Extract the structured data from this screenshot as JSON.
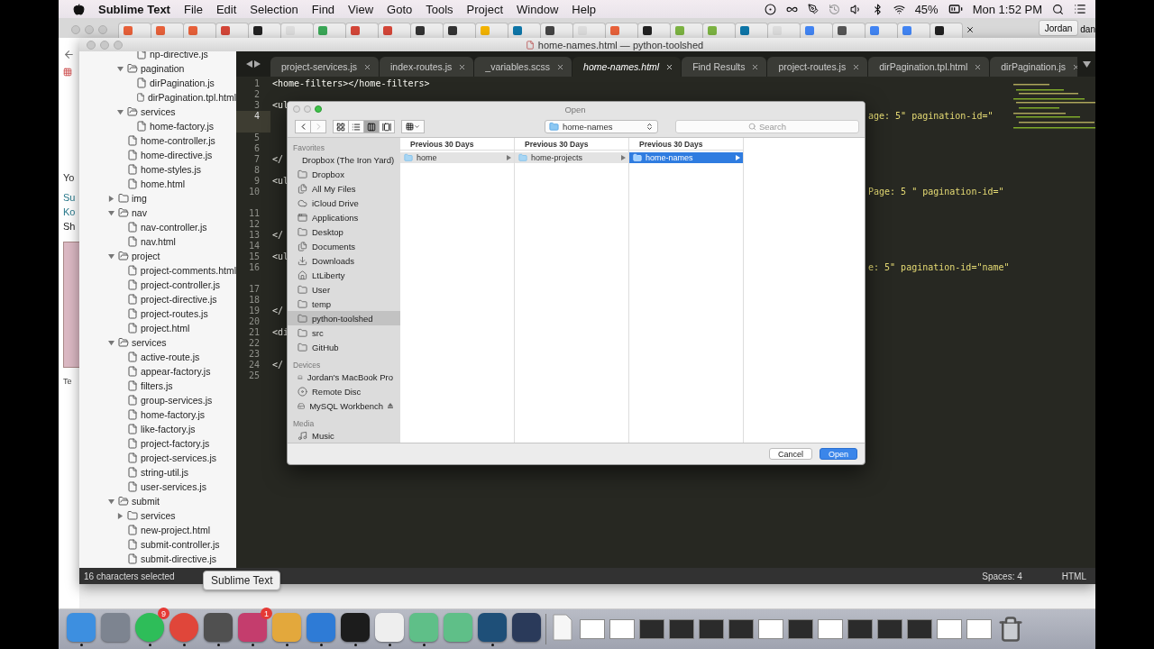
{
  "menu_bar": {
    "app": "Sublime Text",
    "menus": [
      "File",
      "Edit",
      "Selection",
      "Find",
      "View",
      "Goto",
      "Tools",
      "Project",
      "Window",
      "Help"
    ],
    "battery": "45%",
    "clock": "Mon 1:52 PM"
  },
  "browser": {
    "tabs": [
      {
        "color": "#e8613a"
      },
      {
        "color": "#e8613a"
      },
      {
        "color": "#e8613a"
      },
      {
        "color": "#d44638"
      },
      {
        "color": "#222222"
      },
      {
        "color": "#dddddd"
      },
      {
        "color": "#3aa757"
      },
      {
        "color": "#d44638"
      },
      {
        "color": "#d44638"
      },
      {
        "color": "#333333"
      },
      {
        "color": "#333333"
      },
      {
        "color": "#f4b400"
      },
      {
        "color": "#0e76a8"
      },
      {
        "color": "#444444"
      },
      {
        "color": "#dddddd"
      },
      {
        "color": "#e8613a"
      },
      {
        "color": "#222222"
      },
      {
        "color": "#7cb342"
      },
      {
        "color": "#7cb342"
      },
      {
        "color": "#0e76a8"
      },
      {
        "color": "#dddddd"
      },
      {
        "color": "#4285f4"
      },
      {
        "color": "#555555"
      },
      {
        "color": "#4285f4"
      },
      {
        "color": "#4285f4"
      },
      {
        "color": "#222222"
      }
    ],
    "profile": "Jordan",
    "other_window": "dan",
    "page_fragments": [
      "Yo",
      "Su",
      "Ko",
      "Sh",
      "Te"
    ]
  },
  "editor_window": {
    "title": "home-names.html — python-toolshed",
    "sidebar": [
      {
        "kind": "offscreen",
        "children": [
          {
            "kind": "offscreen",
            "children": [
              {
                "name": "np-directive.js",
                "kind": "file"
              }
            ]
          },
          {
            "name": "pagination",
            "kind": "folder",
            "expanded": true,
            "children": [
              {
                "name": "dirPagination.js",
                "kind": "file"
              },
              {
                "name": "dirPagination.tpl.html",
                "kind": "file"
              }
            ]
          },
          {
            "name": "services",
            "kind": "folder",
            "expanded": true,
            "children": [
              {
                "name": "home-factory.js",
                "kind": "file"
              }
            ]
          },
          {
            "name": "home-controller.js",
            "kind": "file"
          },
          {
            "name": "home-directive.js",
            "kind": "file"
          },
          {
            "name": "home-styles.js",
            "kind": "file"
          },
          {
            "name": "home.html",
            "kind": "file"
          }
        ]
      },
      {
        "name": "img",
        "kind": "folder",
        "expanded": false
      },
      {
        "name": "nav",
        "kind": "folder",
        "expanded": true,
        "children": [
          {
            "name": "nav-controller.js",
            "kind": "file"
          },
          {
            "name": "nav.html",
            "kind": "file"
          }
        ]
      },
      {
        "name": "project",
        "kind": "folder",
        "expanded": true,
        "children": [
          {
            "name": "project-comments.html",
            "kind": "file"
          },
          {
            "name": "project-controller.js",
            "kind": "file"
          },
          {
            "name": "project-directive.js",
            "kind": "file"
          },
          {
            "name": "project-routes.js",
            "kind": "file"
          },
          {
            "name": "project.html",
            "kind": "file"
          }
        ]
      },
      {
        "name": "services",
        "kind": "folder",
        "expanded": true,
        "children": [
          {
            "name": "active-route.js",
            "kind": "file"
          },
          {
            "name": "appear-factory.js",
            "kind": "file"
          },
          {
            "name": "filters.js",
            "kind": "file"
          },
          {
            "name": "group-services.js",
            "kind": "file"
          },
          {
            "name": "home-factory.js",
            "kind": "file"
          },
          {
            "name": "like-factory.js",
            "kind": "file"
          },
          {
            "name": "project-factory.js",
            "kind": "file"
          },
          {
            "name": "project-services.js",
            "kind": "file"
          },
          {
            "name": "string-util.js",
            "kind": "file"
          },
          {
            "name": "user-services.js",
            "kind": "file"
          }
        ]
      },
      {
        "name": "submit",
        "kind": "folder",
        "expanded": true,
        "children": [
          {
            "name": "services",
            "kind": "folder",
            "expanded": false
          },
          {
            "name": "new-project.html",
            "kind": "file"
          },
          {
            "name": "submit-controller.js",
            "kind": "file"
          },
          {
            "name": "submit-directive.js",
            "kind": "file"
          }
        ]
      }
    ],
    "tabs": [
      {
        "label": "project-services.js",
        "selected": false
      },
      {
        "label": "index-routes.js",
        "selected": false
      },
      {
        "label": "_variables.scss",
        "selected": false
      },
      {
        "label": "home-names.html",
        "selected": true
      },
      {
        "label": "Find Results",
        "selected": false
      },
      {
        "label": "project-routes.js",
        "selected": false
      },
      {
        "label": "dirPagination.tpl.html",
        "selected": false
      },
      {
        "label": "dirPagination.js",
        "selected": false
      }
    ],
    "lines": [
      {
        "number": "1",
        "text": "<home-filters></home-filters>",
        "current": false,
        "wrapped": false
      },
      {
        "number": "2",
        "current": false,
        "wrapped": false
      },
      {
        "number": "3",
        "text": "<ul",
        "current": false,
        "wrapped": false
      },
      {
        "number": "4",
        "right": "age: 5\" pagination-id=\"",
        "current": true,
        "wrapped": true
      },
      {
        "number": "5",
        "current": false,
        "wrapped": false
      },
      {
        "number": "6",
        "current": false,
        "wrapped": false
      },
      {
        "number": "7",
        "text": "</",
        "current": false,
        "wrapped": false
      },
      {
        "number": "8",
        "current": false,
        "wrapped": false
      },
      {
        "number": "9",
        "text": "<ul",
        "current": false,
        "wrapped": false
      },
      {
        "number": "10",
        "right": "Page: 5 \" pagination-id=\"",
        "current": false,
        "wrapped": true
      },
      {
        "number": "11",
        "current": false,
        "wrapped": false
      },
      {
        "number": "12",
        "current": false,
        "wrapped": false
      },
      {
        "number": "13",
        "text": "</",
        "current": false,
        "wrapped": false
      },
      {
        "number": "14",
        "current": false,
        "wrapped": false
      },
      {
        "number": "15",
        "text": "<ul",
        "current": false,
        "wrapped": false
      },
      {
        "number": "16",
        "right": "e: 5\" pagination-id=\"name\"",
        "current": false,
        "wrapped": true
      },
      {
        "number": "17",
        "current": false,
        "wrapped": false
      },
      {
        "number": "18",
        "current": false,
        "wrapped": false
      },
      {
        "number": "19",
        "text": "</",
        "current": false,
        "wrapped": false
      },
      {
        "number": "20",
        "current": false,
        "wrapped": false
      },
      {
        "number": "21",
        "text": "<di",
        "current": false,
        "wrapped": false
      },
      {
        "number": "22",
        "current": false,
        "wrapped": false
      },
      {
        "number": "23",
        "current": false,
        "wrapped": false
      },
      {
        "number": "24",
        "text": "</",
        "current": false,
        "wrapped": false
      },
      {
        "number": "25",
        "current": false,
        "wrapped": false
      }
    ],
    "status": {
      "selection": "16 characters selected",
      "indent": "Spaces: 4",
      "syntax": "HTML"
    }
  },
  "dialog": {
    "title": "Open",
    "view_modes": [
      {
        "kind": "icons",
        "selected": false
      },
      {
        "kind": "list",
        "selected": false
      },
      {
        "kind": "columns",
        "selected": true
      },
      {
        "kind": "coverflow",
        "selected": false
      }
    ],
    "location": "home-names",
    "search_placeholder": "Search",
    "sidebar": [
      {
        "heading": "Favorites",
        "items": [
          {
            "label": "Dropbox (The Iron Yard)",
            "kind": "folder",
            "selected": false
          },
          {
            "label": "Dropbox",
            "kind": "folder",
            "selected": false
          },
          {
            "label": "All My Files",
            "kind": "files",
            "selected": false
          },
          {
            "label": "iCloud Drive",
            "kind": "cloud",
            "selected": false
          },
          {
            "label": "Applications",
            "kind": "apps",
            "selected": false
          },
          {
            "label": "Desktop",
            "kind": "folder",
            "selected": false
          },
          {
            "label": "Documents",
            "kind": "files",
            "selected": false
          },
          {
            "label": "Downloads",
            "kind": "download",
            "selected": false
          },
          {
            "label": "LtLiberty",
            "kind": "home",
            "selected": false
          },
          {
            "label": "User",
            "kind": "folder",
            "selected": false
          },
          {
            "label": "temp",
            "kind": "folder",
            "selected": false
          },
          {
            "label": "python-toolshed",
            "kind": "folder",
            "selected": true
          },
          {
            "label": "src",
            "kind": "folder",
            "selected": false
          },
          {
            "label": "GitHub",
            "kind": "folder",
            "selected": false
          }
        ]
      },
      {
        "heading": "Devices",
        "items": [
          {
            "label": "Jordan's MacBook Pro",
            "kind": "laptop",
            "selected": false
          },
          {
            "label": "Remote Disc",
            "kind": "disc",
            "selected": false
          },
          {
            "label": "MySQL Workbench",
            "kind": "drive",
            "selected": false
          }
        ]
      },
      {
        "heading": "Media",
        "items": [
          {
            "label": "Music",
            "kind": "music",
            "selected": false
          }
        ]
      }
    ],
    "columns": [
      {
        "heading": "Previous 30 Days",
        "item": "home",
        "selected": false
      },
      {
        "heading": "Previous 30 Days",
        "item": "home-projects",
        "selected": false
      },
      {
        "heading": "Previous 30 Days",
        "item": "home-names",
        "selected": true
      }
    ],
    "buttons": [
      {
        "label": "Cancel",
        "kind": "secondary"
      },
      {
        "label": "Open",
        "kind": "primary"
      }
    ]
  },
  "tooltip": "Sublime Text",
  "dock": [
    {
      "kind": "app",
      "color": "#3d8fe0",
      "running": true
    },
    {
      "kind": "app",
      "color": "#7d8490",
      "running": false
    },
    {
      "kind": "app",
      "color": "#2ebd59",
      "running": true,
      "badge": "9"
    },
    {
      "kind": "app",
      "color": "#e0463a",
      "running": true
    },
    {
      "kind": "app",
      "color": "#505050",
      "running": true
    },
    {
      "kind": "app",
      "color": "#c43d6d",
      "running": true,
      "badge": "1"
    },
    {
      "kind": "app",
      "color": "#e3a83c",
      "running": true
    },
    {
      "kind": "app",
      "color": "#2e7bd6",
      "running": true
    },
    {
      "kind": "app",
      "color": "#1c1c1c",
      "running": true
    },
    {
      "kind": "app",
      "color": "#eeeeee",
      "running": true
    },
    {
      "kind": "app",
      "color": "#5fbf88",
      "running": true
    },
    {
      "kind": "app",
      "color": "#5fbf88",
      "running": false
    },
    {
      "kind": "app",
      "color": "#1e4f78",
      "running": true
    },
    {
      "kind": "app",
      "color": "#2a3a5a",
      "running": false
    },
    {
      "kind": "separator"
    },
    {
      "kind": "document",
      "color": "#f6f6f6"
    },
    {
      "kind": "thumb",
      "color": "#ffffff"
    },
    {
      "kind": "thumb",
      "color": "#ffffff"
    },
    {
      "kind": "thumb",
      "color": "#2b2b2b"
    },
    {
      "kind": "thumb",
      "color": "#2b2b2b"
    },
    {
      "kind": "thumb",
      "color": "#2b2b2b"
    },
    {
      "kind": "thumb",
      "color": "#2b2b2b"
    },
    {
      "kind": "thumb",
      "color": "#ffffff"
    },
    {
      "kind": "thumb",
      "color": "#2b2b2b"
    },
    {
      "kind": "thumb",
      "color": "#ffffff"
    },
    {
      "kind": "thumb",
      "color": "#2b2b2b"
    },
    {
      "kind": "thumb",
      "color": "#2b2b2b"
    },
    {
      "kind": "thumb",
      "color": "#2b2b2b"
    },
    {
      "kind": "thumb",
      "color": "#ffffff"
    },
    {
      "kind": "thumb",
      "color": "#ffffff"
    },
    {
      "kind": "trash",
      "color": "#c9ccd1"
    }
  ]
}
